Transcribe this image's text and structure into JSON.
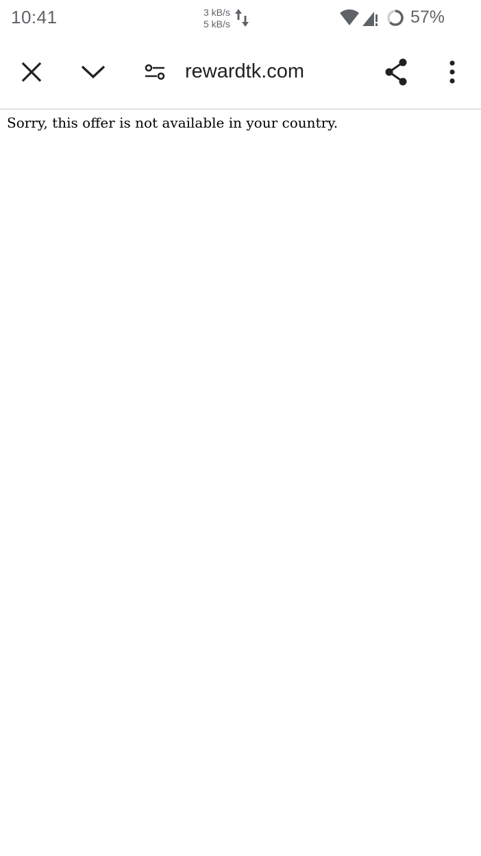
{
  "status_bar": {
    "time": "10:41",
    "upload_speed": "3 kB/s",
    "download_speed": "5 kB/s",
    "battery_percent": "57%",
    "icons": [
      "network-activity-icon",
      "wifi-icon",
      "cell-signal-icon",
      "battery-saver-icon"
    ]
  },
  "toolbar": {
    "close_icon": "close-icon",
    "minimize_icon": "chevron-down-icon",
    "site_settings_icon": "tune-icon",
    "url": "rewardtk.com",
    "share_icon": "share-icon",
    "more_icon": "more-vert-icon"
  },
  "page": {
    "message": "Sorry, this offer is not available in your country."
  },
  "colors": {
    "status_text": "#5f6368",
    "toolbar_icon": "#202124",
    "divider": "#e3e3e3",
    "background": "#ffffff"
  }
}
